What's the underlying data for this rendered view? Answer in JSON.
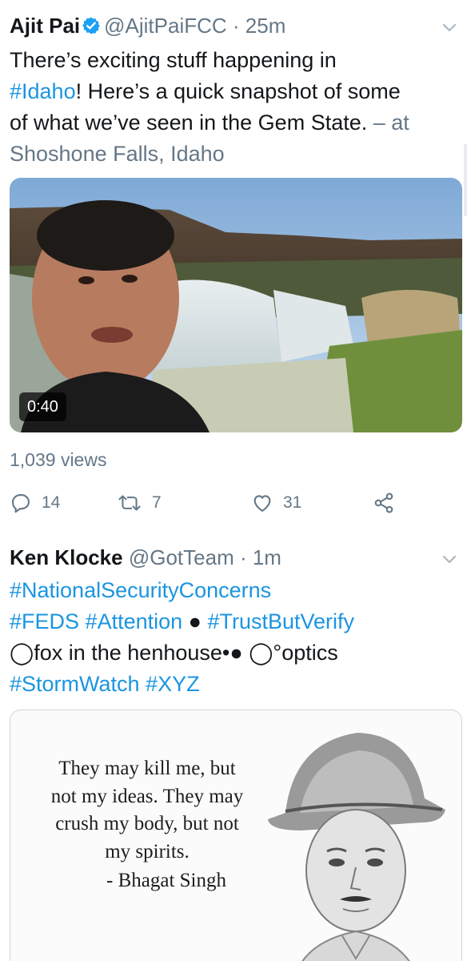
{
  "tweets": [
    {
      "author_name": "Ajit Pai",
      "author_handle": "@AjitPaiFCC",
      "separator": " · ",
      "time": "25m",
      "text_line1_a": "There’s exciting stuff happening in",
      "hashtag_idaho": "#Idaho",
      "text_line2_b": "! Here’s a quick snapshot of some",
      "text_line3": "of what we’ve seen in the Gem State.",
      "location_prefix": " – at",
      "location": "Shoshone Falls, Idaho",
      "video_duration": "0:40",
      "views": "1,039 views",
      "replies": "14",
      "retweets": "7",
      "likes": "31"
    },
    {
      "author_name": "Ken Klocke",
      "author_handle": "@GotTeam",
      "separator": " · ",
      "time": "1m",
      "hashtag_nsc": "#NationalSecurityConcerns",
      "hashtag_feds": "#FEDS",
      "hashtag_attention": "#Attention",
      "black_circle": "●",
      "hashtag_tbv": "#TrustButVerify",
      "white_circle": "◯",
      "text_henhouse": "fox in the henhouse•",
      "text_optics": "°optics",
      "hashtag_stormwatch": "#StormWatch",
      "hashtag_xyz": "#XYZ",
      "quote_lines": [
        "They may kill me, but",
        "not my ideas. They may",
        "crush my body, but not",
        "my spirits."
      ],
      "quote_attribution": "- Bhagat Singh"
    }
  ],
  "colors": {
    "link": "#1b95e0",
    "muted": "#657786",
    "verified": "#1da1f2",
    "text": "#14171a"
  },
  "icons": [
    "verified-badge-icon",
    "chevron-down-icon",
    "reply-icon",
    "retweet-icon",
    "like-icon",
    "share-icon"
  ]
}
